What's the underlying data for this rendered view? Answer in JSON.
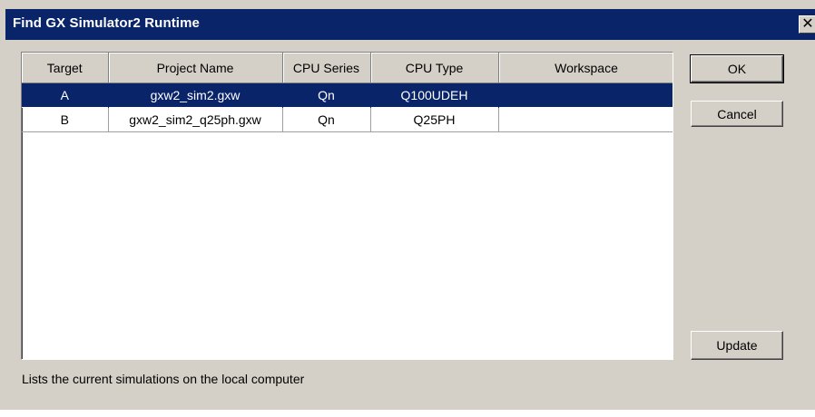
{
  "window": {
    "title": "Find GX Simulator2 Runtime",
    "close_glyph": "✕"
  },
  "table": {
    "columns": [
      "Target",
      "Project Name",
      "CPU Series",
      "CPU Type",
      "Workspace"
    ],
    "rows": [
      {
        "target": "A",
        "project": "gxw2_sim2.gxw",
        "series": "Qn",
        "type": "Q100UDEH",
        "workspace": "",
        "selected": true
      },
      {
        "target": "B",
        "project": "gxw2_sim2_q25ph.gxw",
        "series": "Qn",
        "type": "Q25PH",
        "workspace": "",
        "selected": false
      }
    ]
  },
  "buttons": {
    "ok": "OK",
    "cancel": "Cancel",
    "update": "Update"
  },
  "status": {
    "text": "Lists the current simulations on the local computer"
  },
  "colors": {
    "title_bar": "#0a246a",
    "selection": "#0a246a",
    "dialog_bg": "#d4d0c8"
  }
}
